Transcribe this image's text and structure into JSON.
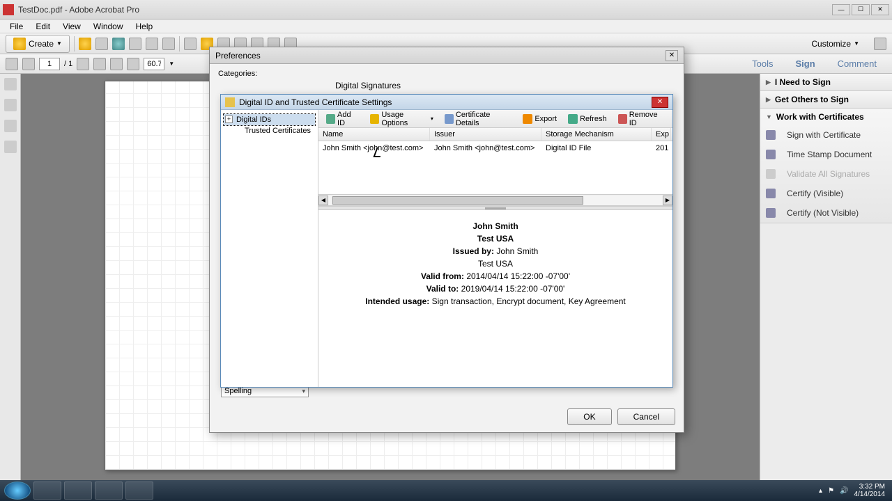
{
  "window": {
    "title": "TestDoc.pdf - Adobe Acrobat Pro"
  },
  "menu": {
    "file": "File",
    "edit": "Edit",
    "view": "View",
    "window": "Window",
    "help": "Help"
  },
  "toolbar": {
    "create": "Create",
    "customize": "Customize"
  },
  "nav": {
    "page": "1",
    "pages": "/ 1",
    "zoom": "60.7%"
  },
  "tabs": {
    "tools": "Tools",
    "sign": "Sign",
    "comment": "Comment"
  },
  "rightpanel": {
    "need": "I Need to Sign",
    "others": "Get Others to Sign",
    "work": "Work with Certificates",
    "items": {
      "signcert": "Sign with Certificate",
      "timestamp": "Time Stamp Document",
      "validate": "Validate All Signatures",
      "certvis": "Certify (Visible)",
      "certnot": "Certify (Not Visible)"
    }
  },
  "prefs": {
    "title": "Preferences",
    "categories": "Categories:",
    "section": "Digital Signatures",
    "spelling": "Spelling",
    "ok": "OK",
    "cancel": "Cancel"
  },
  "cert": {
    "title": "Digital ID and Trusted Certificate Settings",
    "tree": {
      "ids": "Digital IDs",
      "trusted": "Trusted Certificates"
    },
    "toolbar": {
      "add": "Add ID",
      "usage": "Usage Options",
      "details": "Certificate Details",
      "export": "Export",
      "refresh": "Refresh",
      "remove": "Remove ID"
    },
    "cols": {
      "name": "Name",
      "issuer": "Issuer",
      "storage": "Storage Mechanism",
      "exp": "Exp"
    },
    "row": {
      "name": "John Smith <john@test.com>",
      "issuer": "John Smith <john@test.com>",
      "storage": "Digital ID File",
      "exp": "201"
    },
    "detail": {
      "name": "John Smith",
      "org": "Test USA",
      "issued_lbl": "Issued by:",
      "issued": "John Smith",
      "issued_org": "Test USA",
      "vfrom_lbl": "Valid from:",
      "vfrom": "2014/04/14 15:22:00 -07'00'",
      "vto_lbl": "Valid to:",
      "vto": "2019/04/14 15:22:00 -07'00'",
      "usage_lbl": "Intended usage:",
      "usage": "Sign transaction, Encrypt document, Key Agreement"
    }
  },
  "tray": {
    "time": "3:32 PM",
    "date": "4/14/2014"
  }
}
